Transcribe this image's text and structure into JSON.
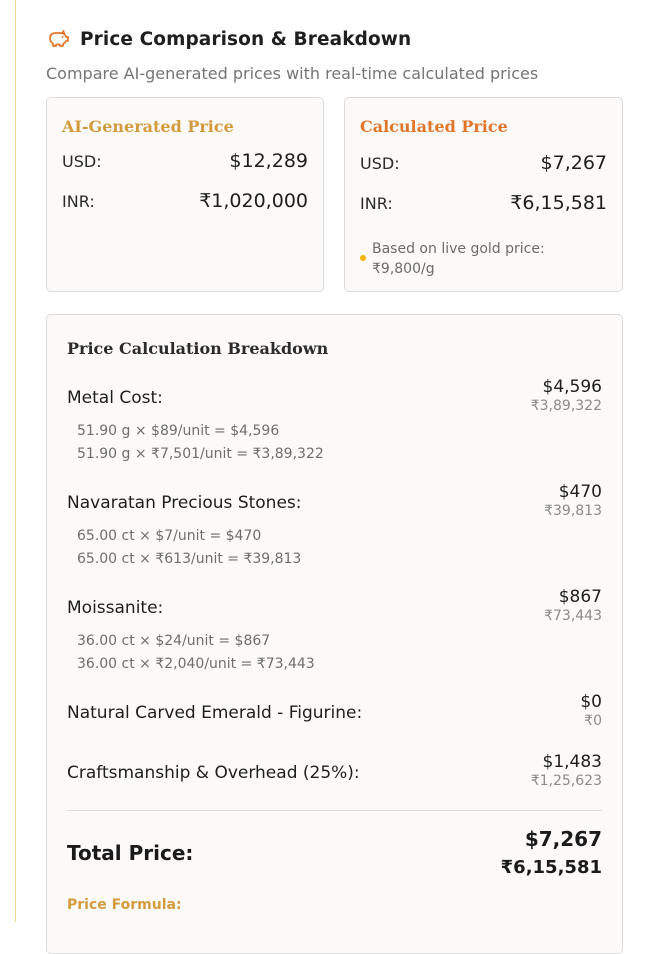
{
  "header": {
    "icon": "piggy-bank-icon",
    "title": "Price Comparison & Breakdown",
    "subtitle": "Compare AI-generated prices with real-time calculated prices"
  },
  "ai_card": {
    "title": "AI-Generated Price",
    "usd_label": "USD:",
    "usd_value": "$12,289",
    "inr_label": "INR:",
    "inr_value": "₹1,020,000"
  },
  "calc_card": {
    "title": "Calculated Price",
    "usd_label": "USD:",
    "usd_value": "$7,267",
    "inr_label": "INR:",
    "inr_value": "₹6,15,581",
    "note": "Based on live gold price: ₹9,800/g"
  },
  "breakdown": {
    "title": "Price Calculation Breakdown",
    "items": [
      {
        "name": "Metal Cost:",
        "usd": "$4,596",
        "inr": "₹3,89,322",
        "lines": [
          "51.90 g × $89/unit = $4,596",
          "51.90 g × ₹7,501/unit = ₹3,89,322"
        ]
      },
      {
        "name": "Navaratan Precious Stones:",
        "usd": "$470",
        "inr": "₹39,813",
        "lines": [
          "65.00 ct × $7/unit = $470",
          "65.00 ct × ₹613/unit = ₹39,813"
        ]
      },
      {
        "name": "Moissanite:",
        "usd": "$867",
        "inr": "₹73,443",
        "lines": [
          "36.00 ct × $24/unit = $867",
          "36.00 ct × ₹2,040/unit = ₹73,443"
        ]
      },
      {
        "name": "Natural Carved Emerald - Figurine:",
        "usd": "$0",
        "inr": "₹0",
        "lines": []
      },
      {
        "name": "Craftsmanship & Overhead (25%):",
        "usd": "$1,483",
        "inr": "₹1,25,623",
        "lines": []
      }
    ],
    "total_label": "Total Price:",
    "total_usd": "$7,267",
    "total_inr": "₹6,15,581",
    "formula_label": "Price Formula:"
  }
}
